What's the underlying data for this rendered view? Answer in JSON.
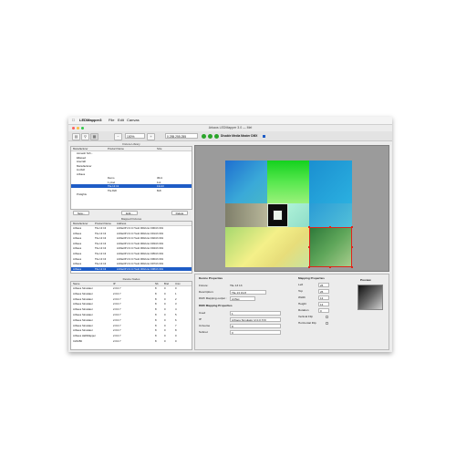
{
  "app": {
    "name": "LEDMapper3",
    "menus": [
      "File",
      "Edit",
      "Canvas"
    ],
    "window_title": "Arkaos LEDMapper 3.0 — Mel"
  },
  "toolbar": {
    "zoom": "100%",
    "color_value": "0.255.255.255",
    "disable_dmx_label": "Disable Media Master DMX"
  },
  "fixture_library": {
    "title": "Fixture Library",
    "columns": [
      "Manufacturer",
      "Product Name",
      "Size"
    ],
    "rows": [
      {
        "manufacturer": "Acmesh Sch...",
        "product": "",
        "size": ""
      },
      {
        "manufacturer": "Elkaved",
        "product": "",
        "size": ""
      },
      {
        "manufacturer": "Litecraft",
        "product": "",
        "size": ""
      },
      {
        "manufacturer": "Manufacturer",
        "product": "",
        "size": ""
      },
      {
        "manufacturer": "Lionfell",
        "product": "",
        "size": ""
      },
      {
        "manufacturer": "ArKaos",
        "product": "",
        "size": ""
      },
      {
        "manufacturer": "",
        "product": "Demo",
        "size": "36x1"
      },
      {
        "manufacturer": "",
        "product": "1 pixel",
        "size": "1x1"
      },
      {
        "manufacturer": "",
        "product": "Tile 13 13",
        "size": "13x13"
      },
      {
        "manufacturer": "",
        "product": "Tile 8x8",
        "size": "8x8"
      },
      {
        "manufacturer": "Prolights",
        "product": "",
        "size": ""
      }
    ],
    "buttons": [
      "New...",
      "Edit...",
      "Delete"
    ]
  },
  "mapped_fixtures": {
    "title": "Mapped Fixtures",
    "columns": [
      "Manufacturer",
      "Product Name",
      "Address"
    ],
    "rows": [
      {
        "manufacturer": "ArKaos",
        "product": "Tile 13 13",
        "address": "ArtNetIP 2.0.0.7/sub 000/univ 000/ch 001"
      },
      {
        "manufacturer": "ArKaos",
        "product": "Tile 13 13",
        "address": "ArtNetIP 2.0.0.7/sub 000/univ 001/ch 001"
      },
      {
        "manufacturer": "ArKaos",
        "product": "Tile 13 13",
        "address": "ArtNetIP 2.0.0.7/sub 000/univ 002/ch 001"
      },
      {
        "manufacturer": "ArKaos",
        "product": "Tile 13 13",
        "address": "ArtNetIP 2.0.0.7/sub 000/univ 003/ch 001"
      },
      {
        "manufacturer": "ArKaos",
        "product": "Tile 13 13",
        "address": "ArtNetIP 2.0.0.7/sub 000/univ 004/ch 001"
      },
      {
        "manufacturer": "ArKaos",
        "product": "Tile 13 13",
        "address": "ArtNetIP 2.0.0.7/sub 000/univ 005/ch 001"
      },
      {
        "manufacturer": "ArKaos",
        "product": "Tile 13 13",
        "address": "ArtNetIP 2.0.0.7/sub 000/univ 006/ch 001"
      },
      {
        "manufacturer": "ArKaos",
        "product": "Tile 13 13",
        "address": "ArtNetIP 2.0.0.7/sub 000/univ 007/ch 001"
      },
      {
        "manufacturer": "ArKaos",
        "product": "Tile 13 13",
        "address": "ArtNetIP 2.0.0.7/sub 000/univ 008/ch 001"
      }
    ]
  },
  "device_nodes": {
    "title": "Device Nodes",
    "columns": [
      "Name",
      "IP",
      "Nb",
      "Bnd",
      "Univ"
    ],
    "rows": [
      {
        "name": "ArKaos Simulator",
        "ip": "2.0.0.7",
        "nb": "8",
        "bnd": "0",
        "univ": "0"
      },
      {
        "name": "ArKaos Simulator",
        "ip": "2.0.0.7",
        "nb": "8",
        "bnd": "0",
        "univ": "1"
      },
      {
        "name": "ArKaos Simulator",
        "ip": "2.0.0.7",
        "nb": "8",
        "bnd": "0",
        "univ": "2"
      },
      {
        "name": "ArKaos Simulator",
        "ip": "2.0.0.7",
        "nb": "8",
        "bnd": "0",
        "univ": "3"
      },
      {
        "name": "ArKaos Simulator",
        "ip": "2.0.0.7",
        "nb": "8",
        "bnd": "0",
        "univ": "4"
      },
      {
        "name": "ArKaos Simulator",
        "ip": "2.0.0.7",
        "nb": "8",
        "bnd": "0",
        "univ": "5"
      },
      {
        "name": "ArKaos Simulator",
        "ip": "2.0.0.7",
        "nb": "8",
        "bnd": "0",
        "univ": "6"
      },
      {
        "name": "ArKaos Simulator",
        "ip": "2.0.0.7",
        "nb": "8",
        "bnd": "0",
        "univ": "7"
      },
      {
        "name": "ArKaos Simulator",
        "ip": "2.0.0.7",
        "nb": "8",
        "bnd": "0",
        "univ": "8"
      },
      {
        "name": "ArKaos LEDMapper",
        "ip": "2.0.0.7",
        "nb": "8",
        "bnd": "0",
        "univ": "0"
      },
      {
        "name": "CZ4456",
        "ip": "2.0.0.7",
        "nb": "8",
        "bnd": "0",
        "univ": "0"
      }
    ]
  },
  "device_properties": {
    "title": "Device Properties",
    "fixture_label": "Fixture:",
    "fixture_value": "Tile 13 13",
    "description_label": "Description:",
    "description_value": "Tile 13 13-8",
    "dmx_output_label": "DMX Mapping output :",
    "dmx_output_value": "ArtNet",
    "dmx_mapping_title": "DMX Mapping Properties",
    "used_label": "Used",
    "used_value": "1",
    "ip_label": "IP",
    "ip_value": "ArKaos Simulator (2.0.0.7/3)",
    "universe_label": "Universe",
    "universe_value": "8",
    "subnet_label": "Subnet",
    "subnet_value": "0"
  },
  "mapping_properties": {
    "title": "Mapping Properties",
    "preview_label": "Preview",
    "left_label": "Left",
    "left_value": "26",
    "top_label": "Top",
    "top_value": "26",
    "width_label": "Width",
    "width_value": "13",
    "height_label": "Height",
    "height_value": "13",
    "rotation_label": "Rotation",
    "rotation_value": "0",
    "vflip_label": "Vertical Flip",
    "hflip_label": "Horizontal Flip"
  },
  "colors": {
    "selection": "#1e5cc6",
    "active_green": "#2aa52a",
    "handle_red": "#e0241b"
  }
}
